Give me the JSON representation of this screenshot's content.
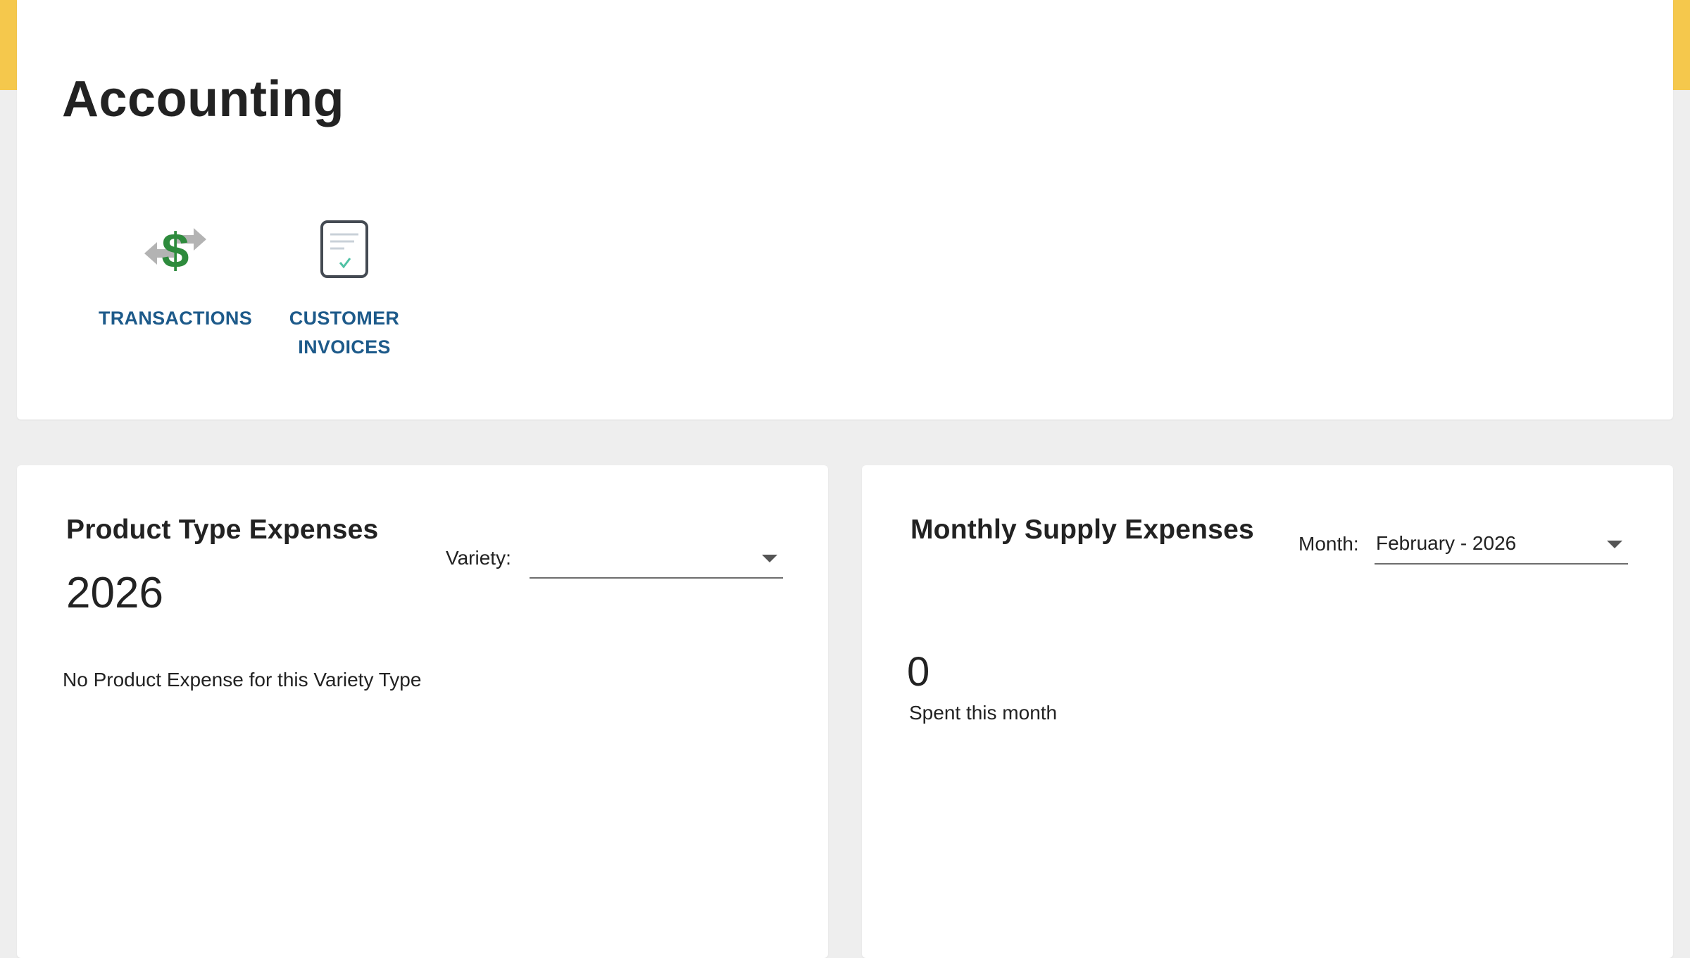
{
  "header": {
    "title": "Accounting"
  },
  "shortcuts": [
    {
      "label": "TRANSACTIONS",
      "icon": "dollar-exchange-icon"
    },
    {
      "label": "CUSTOMER INVOICES",
      "icon": "invoice-icon"
    }
  ],
  "product_expenses": {
    "title": "Product Type Expenses",
    "year": "2026",
    "variety_label": "Variety:",
    "variety_value": "",
    "empty_message": "No Product Expense for this Variety Type"
  },
  "supply_expenses": {
    "title": "Monthly Supply Expenses",
    "month_label": "Month:",
    "month_value": "February - 2026",
    "spent_value": "0",
    "spent_label": "Spent this month"
  },
  "colors": {
    "accent": "#f5c84c",
    "link": "#1d5a8a",
    "dollar_green": "#2e8b3d",
    "background": "#eeeeee"
  }
}
